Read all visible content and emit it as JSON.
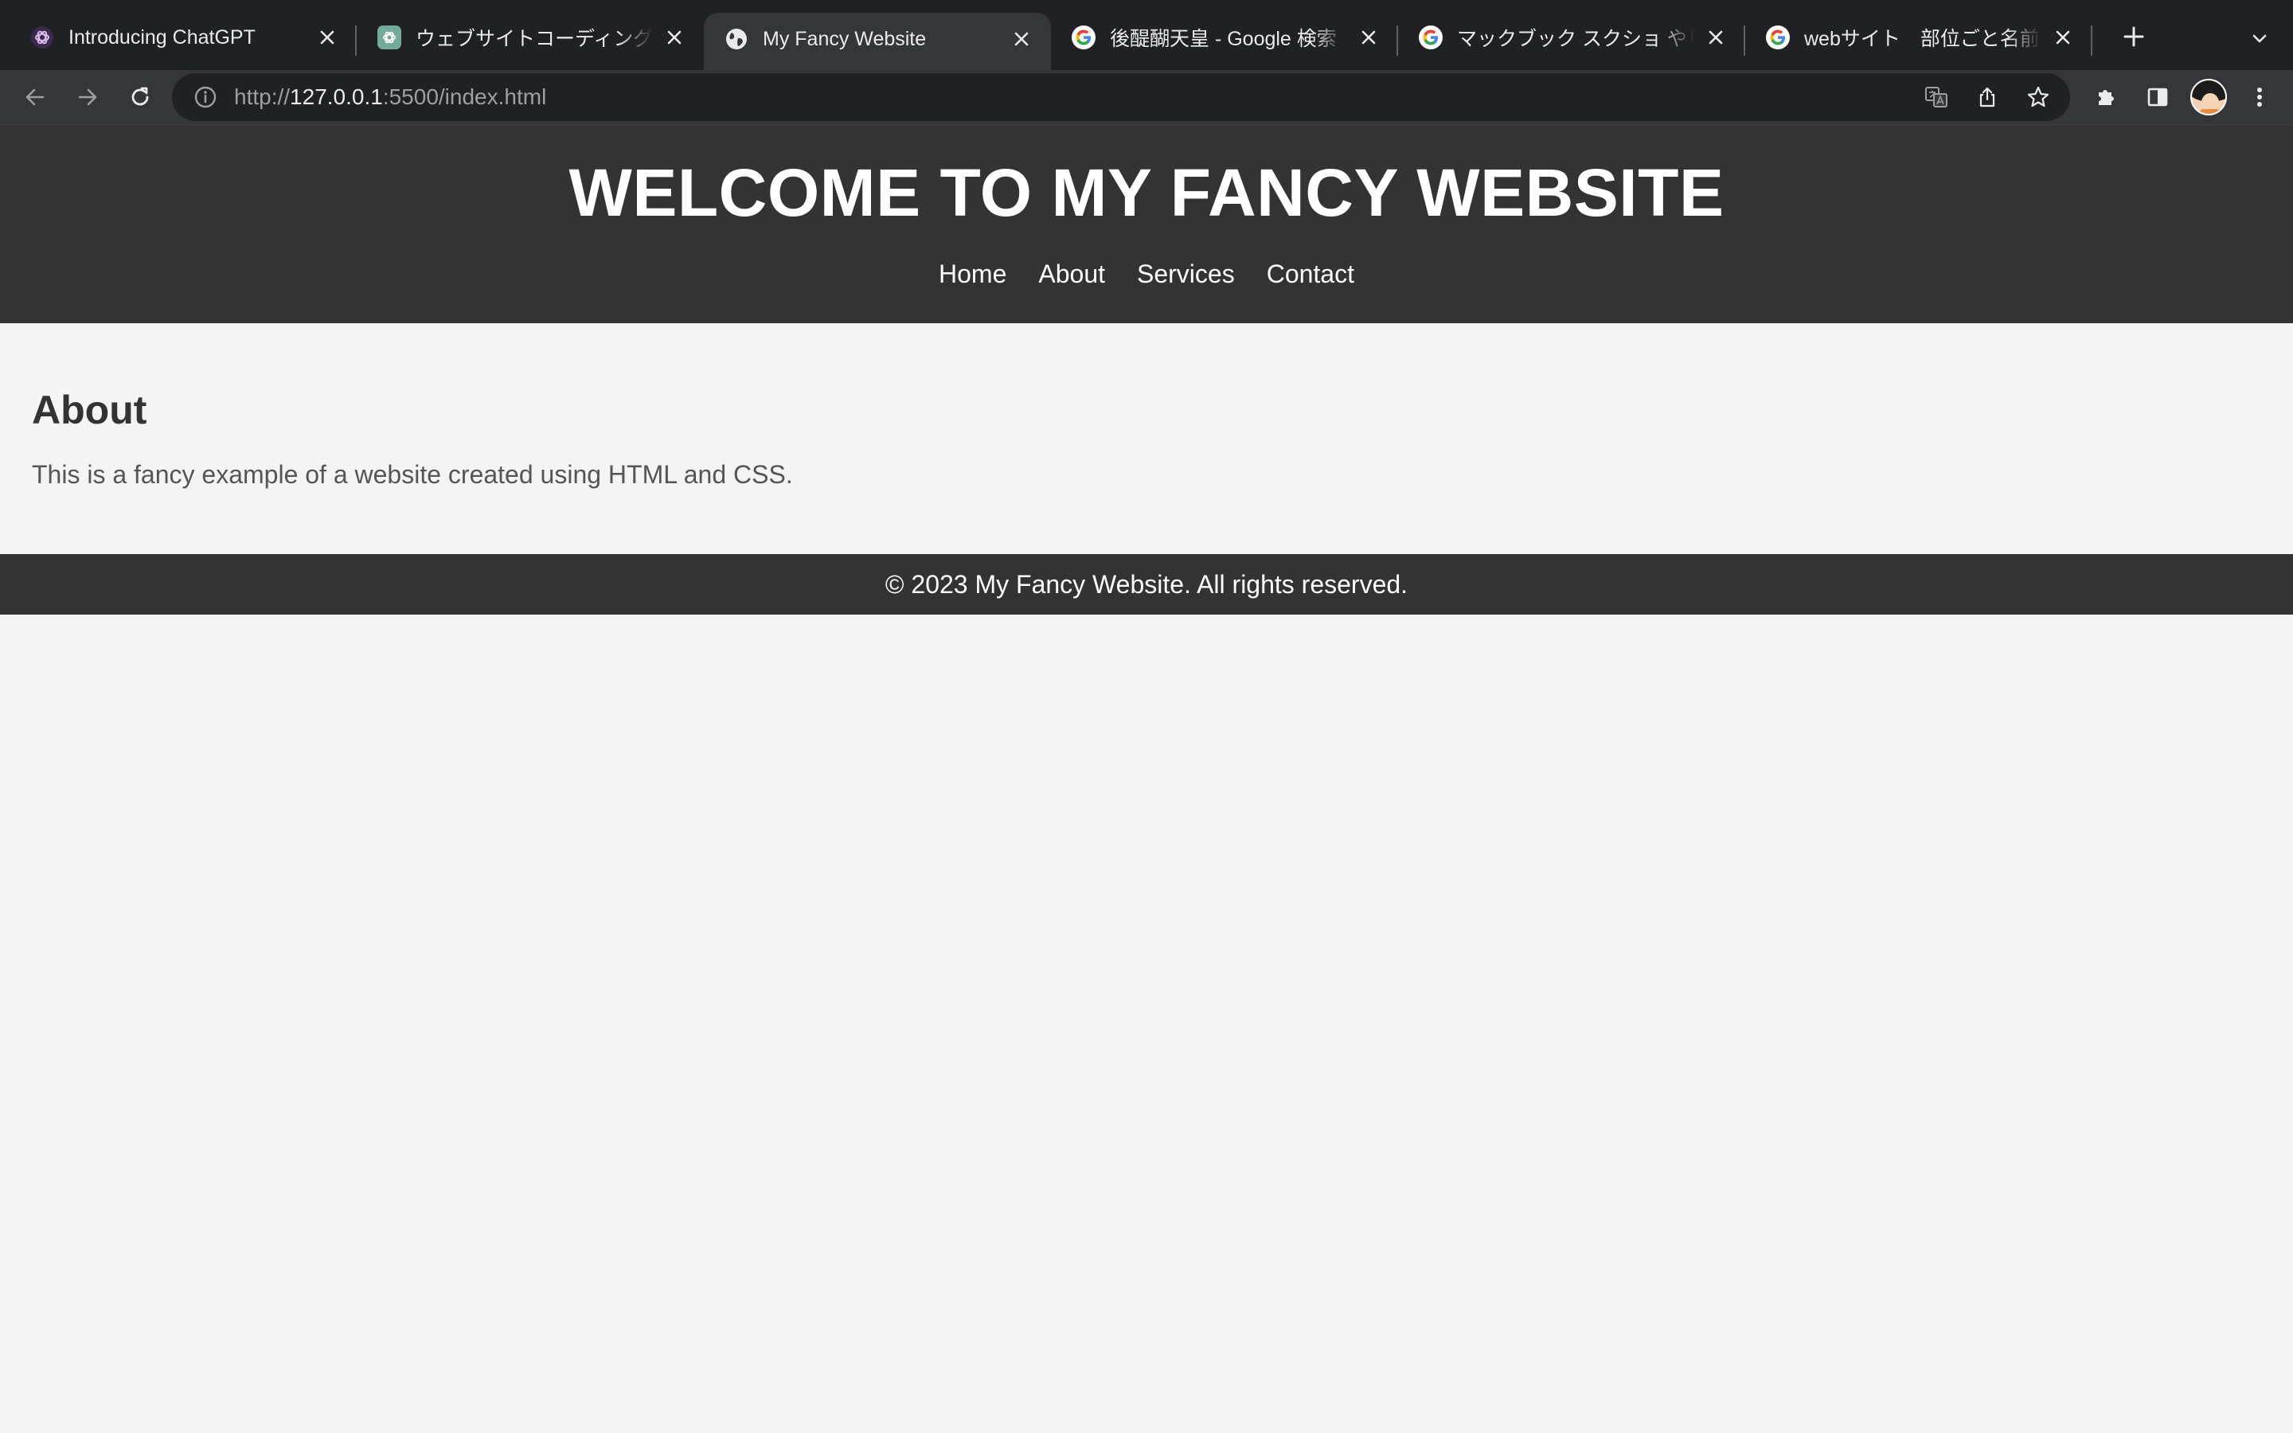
{
  "browser": {
    "tabs": [
      {
        "title": "Introducing ChatGPT",
        "favicon": "openai-color-icon",
        "active": false
      },
      {
        "title": "ウェブサイトコーディング教え",
        "favicon": "chatgpt-icon",
        "active": false
      },
      {
        "title": "My Fancy Website",
        "favicon": "globe-icon",
        "active": true
      },
      {
        "title": "後醍醐天皇 - Google 検索",
        "favicon": "google-icon",
        "active": false
      },
      {
        "title": "マックブック スクショ やり方",
        "favicon": "google-icon",
        "active": false
      },
      {
        "title": "webサイト　部位ごと名前 - G",
        "favicon": "google-icon",
        "active": false
      }
    ],
    "address": {
      "scheme": "http://",
      "host": "127.0.0.1",
      "rest": ":5500/index.html"
    },
    "colors": {
      "tabstrip": "#202124",
      "toolbar": "#35363a",
      "omnibox": "#202124",
      "text": "#e8eaed"
    }
  },
  "site": {
    "header": {
      "title": "WELCOME TO MY FANCY WEBSITE",
      "nav": [
        "Home",
        "About",
        "Services",
        "Contact"
      ]
    },
    "main": {
      "heading": "About",
      "paragraph": "This is a fancy example of a website created using HTML and CSS."
    },
    "footer": {
      "text": "© 2023 My Fancy Website. All rights reserved."
    },
    "colors": {
      "header_bg": "#333333",
      "page_bg": "#f4f4f4",
      "heading": "#333333",
      "paragraph": "#555555"
    }
  }
}
